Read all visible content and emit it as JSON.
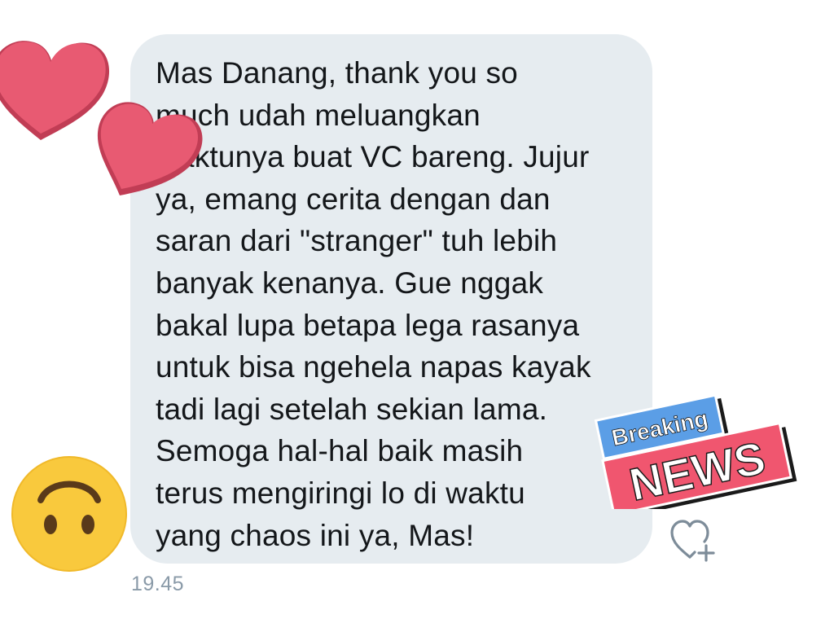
{
  "message": {
    "lines": [
      "Mas Danang, thank you so",
      "much udah meluangkan",
      "waktunya buat VC bareng. Jujur",
      "ya, emang cerita dengan dan",
      "saran dari \"stranger\" tuh lebih",
      "banyak kenanya. Gue nggak",
      "bakal lupa betapa lega rasanya",
      "untuk bisa ngehela napas kayak",
      "tadi lagi setelah sekian lama.",
      "Semoga hal-hal baik masih",
      "terus mengiringi lo di waktu",
      "yang chaos ini ya, Mas!"
    ],
    "timestamp": "19.45"
  },
  "actions": {
    "like_icon": "heart-plus-icon"
  },
  "stickers": {
    "top": "heart-stickers",
    "bottom_left": "upside-down-face-emoji",
    "news": {
      "line1": "Breaking",
      "line2": "NEWS"
    }
  },
  "colors": {
    "bubble": "#e6ecf0",
    "text": "#14171a",
    "timestamp": "#8a9aa8",
    "heart": "#e85a72",
    "news_blue": "#5b9ee6",
    "news_pink": "#f0566f"
  }
}
